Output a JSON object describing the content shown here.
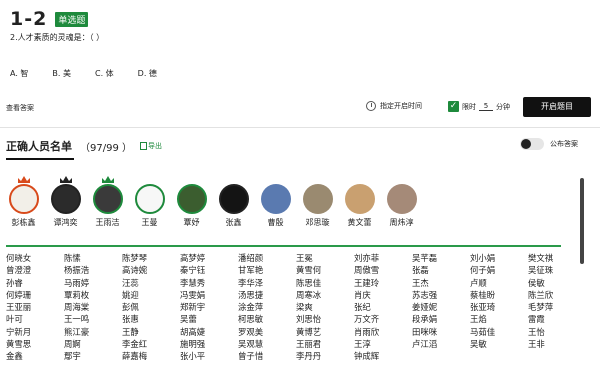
{
  "question": {
    "number": "1-2",
    "type_badge": "单选题",
    "text": "2.人才素质的灵魂是：（        ）",
    "options": [
      "A. 智",
      "B. 美",
      "C. 体",
      "D. 德"
    ]
  },
  "controls": {
    "view_answer": "查看答案",
    "timer_label": "指定开启时间",
    "limit_label": "限时",
    "limit_value": "5",
    "limit_unit": "分钟",
    "start_label": "开启题目"
  },
  "panel": {
    "title": "正确人员名单",
    "count": "（97/99 ）",
    "export_label": "导出",
    "publish_label": "公布答案"
  },
  "top_users": [
    {
      "name": "彭栋鑫",
      "crown": "#d84a1b",
      "ring": "r",
      "bg": "#f2efe8"
    },
    {
      "name": "谭鸿奕",
      "crown": "#222222",
      "ring": "k",
      "bg": "#2b2b2b"
    },
    {
      "name": "王雨洁",
      "crown": "#1e8a3c",
      "ring": "g",
      "bg": "#3a3a3a"
    },
    {
      "name": "王曼",
      "crown": "",
      "ring": "g",
      "bg": "#f7f7f7"
    },
    {
      "name": "覃妤",
      "crown": "",
      "ring": "g",
      "bg": "#3b5d2f"
    },
    {
      "name": "张鑫",
      "crown": "",
      "ring": "k",
      "bg": "#141414"
    },
    {
      "name": "曹殷",
      "crown": "",
      "ring": "",
      "bg": "#5a7ab0"
    },
    {
      "name": "邓思璇",
      "crown": "",
      "ring": "",
      "bg": "#9a8a70"
    },
    {
      "name": "黄文蕾",
      "crown": "",
      "ring": "",
      "bg": "#c9a070"
    },
    {
      "name": "周炜淳",
      "crown": "",
      "ring": "",
      "bg": "#a58a78"
    }
  ],
  "names": [
    "何晓女",
    "陈愫",
    "陈梦琴",
    "高梦婷",
    "潘绍颜",
    "王冕",
    "刘亦菲",
    "吴芊磊",
    "刘小娟",
    "樊文祺",
    "曾澄澄",
    "杨振浩",
    "高诗婉",
    "秦宁钰",
    "甘军艳",
    "黄雪何",
    "周傲雪",
    "张磊",
    "何子娟",
    "吴征珠",
    "孙睿",
    "马雨婷",
    "汪蕊",
    "李慧秀",
    "李华泽",
    "陈思佳",
    "王建玲",
    "王杰",
    "卢顺",
    "侯敏",
    "何婷珊",
    "覃莉枚",
    "姚迎",
    "冯雯娟",
    "汤思捷",
    "周寒冰",
    "肖庆",
    "苏志强",
    "蔡桂盼",
    "陈兰欣",
    "王亚丽",
    "周海棠",
    "彭佩",
    "郑新宇",
    "涂金萍",
    "梁爽",
    "张纪",
    "姜娅妮",
    "张亚琦",
    "毛梦萍",
    "叶可",
    "王一鸣",
    "张惠",
    "吴蕾",
    "柯思敏",
    "刘思怡",
    "万文齐",
    "段承娟",
    "王焰",
    "雷霞",
    "宁新月",
    "熊江豪",
    "王静",
    "胡高婕",
    "罗观美",
    "黄博艺",
    "肖雨欣",
    "田咪咪",
    "马茹佳",
    "王怡",
    "黄雪思",
    "周婀",
    "李金红",
    "施明强",
    "吴观慧",
    "王丽君",
    "王淳",
    "卢江滔",
    "吴敏",
    "王非",
    "金鑫",
    "鄢宇",
    "薛嘉梅",
    "张小平",
    "曾子惜",
    "李丹丹",
    "钟成辉",
    "",
    "",
    ""
  ]
}
